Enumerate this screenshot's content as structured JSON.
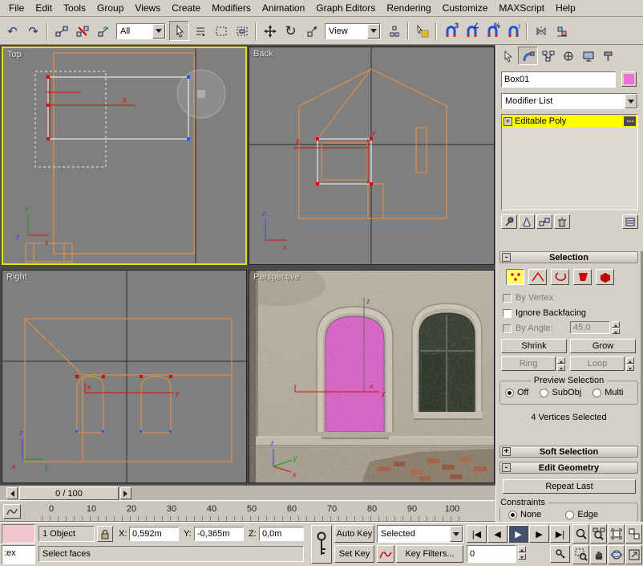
{
  "menu": {
    "items": [
      "File",
      "Edit",
      "Tools",
      "Group",
      "Views",
      "Create",
      "Modifiers",
      "Animation",
      "Graph Editors",
      "Rendering",
      "Customize",
      "MAXScript",
      "Help"
    ]
  },
  "toolbar": {
    "selection_filter_value": "All",
    "reference_coordinate_value": "View",
    "glyphs": {
      "undo": "↶",
      "redo": "↷",
      "rotate": "↻"
    },
    "snap_labels": {
      "three_d": "3",
      "angle": "∠",
      "percent": "%",
      "spinner": "↕"
    }
  },
  "viewports": {
    "top_label": "Top",
    "back_label": "Back",
    "right_label": "Right",
    "perspective_label": "Perspective"
  },
  "axes": {
    "x": "x",
    "y": "y",
    "z": "z",
    "x_upper": "X",
    "y_upper": "Y"
  },
  "command_panel": {
    "object_name": "Box01",
    "object_color": "#ee6fd8",
    "modifier_list_label": "Modifier List",
    "stack_expand": "+",
    "stack_item": "Editable Poly",
    "selection_rollout": {
      "collapse": "-",
      "title": "Selection",
      "by_vertex_label": "By Vertex",
      "ignore_backfacing_label": "Ignore Backfacing",
      "by_angle_label": "By Angle:",
      "by_angle_value": "45,0",
      "shrink_label": "Shrink",
      "grow_label": "Grow",
      "ring_label": "Ring",
      "loop_label": "Loop",
      "preview_group_title": "Preview Selection",
      "preview_off": "Off",
      "preview_subobj": "SubObj",
      "preview_multi": "Multi",
      "status_text": "4 Vertices Selected"
    },
    "soft_selection_rollout": {
      "collapse": "+",
      "title": "Soft Selection"
    },
    "edit_geometry_rollout": {
      "collapse": "-",
      "title": "Edit Geometry",
      "repeat_last_label": "Repeat Last",
      "constraints_title": "Constraints",
      "constraint_none": "None",
      "constraint_edge": "Edge"
    }
  },
  "timeline": {
    "slider_label": "0 / 100",
    "ticks": [
      "0",
      "10",
      "20",
      "30",
      "40",
      "50",
      "60",
      "70",
      "80",
      "90",
      "100"
    ]
  },
  "status_bar": {
    "listener_text": ":ex",
    "object_count": "1 Object",
    "x_label": "X:",
    "x_value": "0,592m",
    "y_label": "Y:",
    "y_value": "-0,365m",
    "z_label": "Z:",
    "z_value": "0,0m",
    "auto_key_label": "Auto Key",
    "set_key_label": "Set Key",
    "key_mode_value": "Selected",
    "key_filters_label": "Key Filters...",
    "frame_value": "0",
    "prompt_text": "Select faces",
    "playback": {
      "go_to_start": "|◀",
      "previous_frame": "◀",
      "play": "▶",
      "next_frame": "▶",
      "go_to_end": "▶|"
    }
  },
  "colors": {
    "active_viewport_border": "#e8dc14",
    "wireframe": "#f0903c",
    "selected_faces": "#d75fc5",
    "stack_highlight": "#ffff00",
    "ui_base": "#d4d0c8",
    "viewport_bg": "#7f7f7f"
  }
}
